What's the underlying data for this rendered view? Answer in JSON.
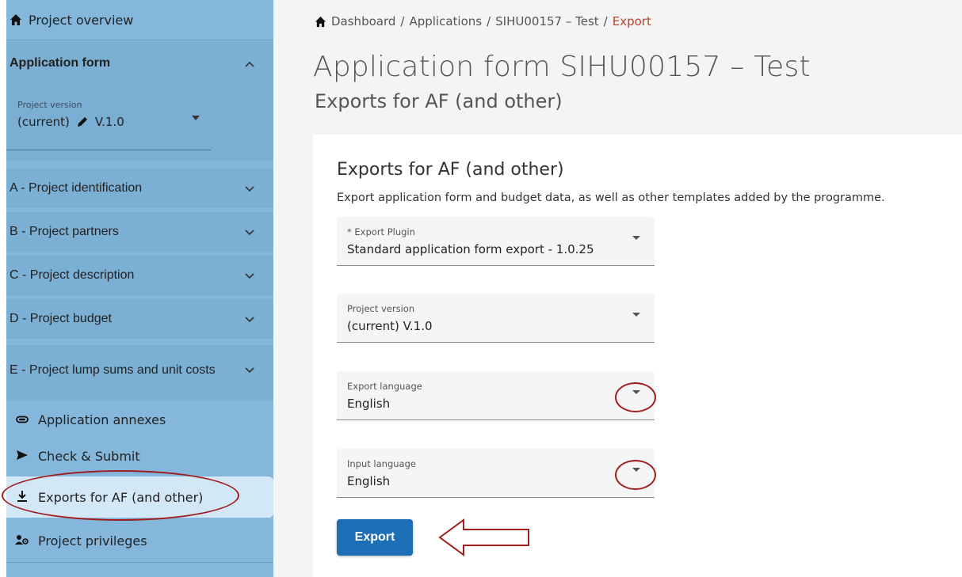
{
  "sidebar": {
    "top_item": {
      "label": "Project overview",
      "icon": "home-icon"
    },
    "section": {
      "label": "Application form",
      "chevron": "chevron-up-icon"
    },
    "version": {
      "label": "Project version",
      "value_prefix": "(current)",
      "value_suffix": "V.1.0",
      "icon": "pencil-icon"
    },
    "items": [
      {
        "label": "A - Project identification"
      },
      {
        "label": "B - Project partners"
      },
      {
        "label": "C - Project description"
      },
      {
        "label": "D - Project budget"
      },
      {
        "label": "E - Project lump sums and unit costs"
      }
    ],
    "lower_items": [
      {
        "label": "Application annexes",
        "icon": "paperclip-icon"
      },
      {
        "label": "Check & Submit",
        "icon": "send-icon"
      },
      {
        "label": "Exports for AF (and other)",
        "icon": "download-icon",
        "active": true
      },
      {
        "label": "Project privileges",
        "icon": "user-gear-icon"
      }
    ]
  },
  "breadcrumb": {
    "items": [
      "Dashboard",
      "Applications",
      "SIHU00157 – Test"
    ],
    "current": "Export",
    "separator": "/"
  },
  "page": {
    "title": "Application form SIHU00157 – Test",
    "subtitle": "Exports for AF (and other)"
  },
  "card": {
    "title": "Exports for AF (and other)",
    "description": "Export application form and budget data, as well as other templates added by the programme.",
    "fields": [
      {
        "label": "* Export Plugin",
        "value": "Standard application form export - 1.0.25"
      },
      {
        "label": "Project version",
        "value": "(current) V.1.0"
      },
      {
        "label": "Export language",
        "value": "English"
      },
      {
        "label": "Input language",
        "value": "English"
      }
    ],
    "export_button": "Export"
  },
  "colors": {
    "sidebar_bg": "#84b7db",
    "active_bg": "#d3e8f6",
    "primary_button": "#1d6fb5",
    "breadcrumb_current": "#b5442e",
    "annotation": "#a11c1c"
  }
}
